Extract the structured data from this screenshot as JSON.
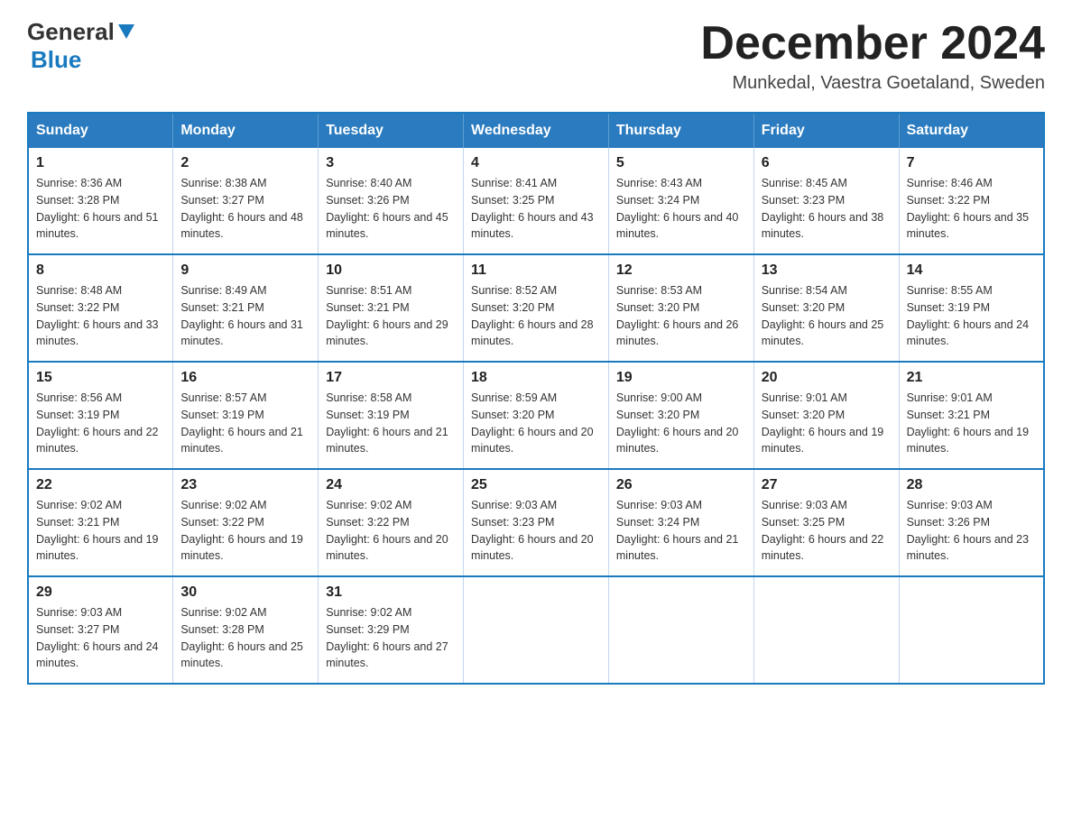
{
  "header": {
    "logo_general": "General",
    "logo_blue": "Blue",
    "month_title": "December 2024",
    "location": "Munkedal, Vaestra Goetaland, Sweden"
  },
  "days_of_week": [
    "Sunday",
    "Monday",
    "Tuesday",
    "Wednesday",
    "Thursday",
    "Friday",
    "Saturday"
  ],
  "weeks": [
    [
      {
        "day": "1",
        "sunrise": "Sunrise: 8:36 AM",
        "sunset": "Sunset: 3:28 PM",
        "daylight": "Daylight: 6 hours and 51 minutes."
      },
      {
        "day": "2",
        "sunrise": "Sunrise: 8:38 AM",
        "sunset": "Sunset: 3:27 PM",
        "daylight": "Daylight: 6 hours and 48 minutes."
      },
      {
        "day": "3",
        "sunrise": "Sunrise: 8:40 AM",
        "sunset": "Sunset: 3:26 PM",
        "daylight": "Daylight: 6 hours and 45 minutes."
      },
      {
        "day": "4",
        "sunrise": "Sunrise: 8:41 AM",
        "sunset": "Sunset: 3:25 PM",
        "daylight": "Daylight: 6 hours and 43 minutes."
      },
      {
        "day": "5",
        "sunrise": "Sunrise: 8:43 AM",
        "sunset": "Sunset: 3:24 PM",
        "daylight": "Daylight: 6 hours and 40 minutes."
      },
      {
        "day": "6",
        "sunrise": "Sunrise: 8:45 AM",
        "sunset": "Sunset: 3:23 PM",
        "daylight": "Daylight: 6 hours and 38 minutes."
      },
      {
        "day": "7",
        "sunrise": "Sunrise: 8:46 AM",
        "sunset": "Sunset: 3:22 PM",
        "daylight": "Daylight: 6 hours and 35 minutes."
      }
    ],
    [
      {
        "day": "8",
        "sunrise": "Sunrise: 8:48 AM",
        "sunset": "Sunset: 3:22 PM",
        "daylight": "Daylight: 6 hours and 33 minutes."
      },
      {
        "day": "9",
        "sunrise": "Sunrise: 8:49 AM",
        "sunset": "Sunset: 3:21 PM",
        "daylight": "Daylight: 6 hours and 31 minutes."
      },
      {
        "day": "10",
        "sunrise": "Sunrise: 8:51 AM",
        "sunset": "Sunset: 3:21 PM",
        "daylight": "Daylight: 6 hours and 29 minutes."
      },
      {
        "day": "11",
        "sunrise": "Sunrise: 8:52 AM",
        "sunset": "Sunset: 3:20 PM",
        "daylight": "Daylight: 6 hours and 28 minutes."
      },
      {
        "day": "12",
        "sunrise": "Sunrise: 8:53 AM",
        "sunset": "Sunset: 3:20 PM",
        "daylight": "Daylight: 6 hours and 26 minutes."
      },
      {
        "day": "13",
        "sunrise": "Sunrise: 8:54 AM",
        "sunset": "Sunset: 3:20 PM",
        "daylight": "Daylight: 6 hours and 25 minutes."
      },
      {
        "day": "14",
        "sunrise": "Sunrise: 8:55 AM",
        "sunset": "Sunset: 3:19 PM",
        "daylight": "Daylight: 6 hours and 24 minutes."
      }
    ],
    [
      {
        "day": "15",
        "sunrise": "Sunrise: 8:56 AM",
        "sunset": "Sunset: 3:19 PM",
        "daylight": "Daylight: 6 hours and 22 minutes."
      },
      {
        "day": "16",
        "sunrise": "Sunrise: 8:57 AM",
        "sunset": "Sunset: 3:19 PM",
        "daylight": "Daylight: 6 hours and 21 minutes."
      },
      {
        "day": "17",
        "sunrise": "Sunrise: 8:58 AM",
        "sunset": "Sunset: 3:19 PM",
        "daylight": "Daylight: 6 hours and 21 minutes."
      },
      {
        "day": "18",
        "sunrise": "Sunrise: 8:59 AM",
        "sunset": "Sunset: 3:20 PM",
        "daylight": "Daylight: 6 hours and 20 minutes."
      },
      {
        "day": "19",
        "sunrise": "Sunrise: 9:00 AM",
        "sunset": "Sunset: 3:20 PM",
        "daylight": "Daylight: 6 hours and 20 minutes."
      },
      {
        "day": "20",
        "sunrise": "Sunrise: 9:01 AM",
        "sunset": "Sunset: 3:20 PM",
        "daylight": "Daylight: 6 hours and 19 minutes."
      },
      {
        "day": "21",
        "sunrise": "Sunrise: 9:01 AM",
        "sunset": "Sunset: 3:21 PM",
        "daylight": "Daylight: 6 hours and 19 minutes."
      }
    ],
    [
      {
        "day": "22",
        "sunrise": "Sunrise: 9:02 AM",
        "sunset": "Sunset: 3:21 PM",
        "daylight": "Daylight: 6 hours and 19 minutes."
      },
      {
        "day": "23",
        "sunrise": "Sunrise: 9:02 AM",
        "sunset": "Sunset: 3:22 PM",
        "daylight": "Daylight: 6 hours and 19 minutes."
      },
      {
        "day": "24",
        "sunrise": "Sunrise: 9:02 AM",
        "sunset": "Sunset: 3:22 PM",
        "daylight": "Daylight: 6 hours and 20 minutes."
      },
      {
        "day": "25",
        "sunrise": "Sunrise: 9:03 AM",
        "sunset": "Sunset: 3:23 PM",
        "daylight": "Daylight: 6 hours and 20 minutes."
      },
      {
        "day": "26",
        "sunrise": "Sunrise: 9:03 AM",
        "sunset": "Sunset: 3:24 PM",
        "daylight": "Daylight: 6 hours and 21 minutes."
      },
      {
        "day": "27",
        "sunrise": "Sunrise: 9:03 AM",
        "sunset": "Sunset: 3:25 PM",
        "daylight": "Daylight: 6 hours and 22 minutes."
      },
      {
        "day": "28",
        "sunrise": "Sunrise: 9:03 AM",
        "sunset": "Sunset: 3:26 PM",
        "daylight": "Daylight: 6 hours and 23 minutes."
      }
    ],
    [
      {
        "day": "29",
        "sunrise": "Sunrise: 9:03 AM",
        "sunset": "Sunset: 3:27 PM",
        "daylight": "Daylight: 6 hours and 24 minutes."
      },
      {
        "day": "30",
        "sunrise": "Sunrise: 9:02 AM",
        "sunset": "Sunset: 3:28 PM",
        "daylight": "Daylight: 6 hours and 25 minutes."
      },
      {
        "day": "31",
        "sunrise": "Sunrise: 9:02 AM",
        "sunset": "Sunset: 3:29 PM",
        "daylight": "Daylight: 6 hours and 27 minutes."
      },
      null,
      null,
      null,
      null
    ]
  ]
}
